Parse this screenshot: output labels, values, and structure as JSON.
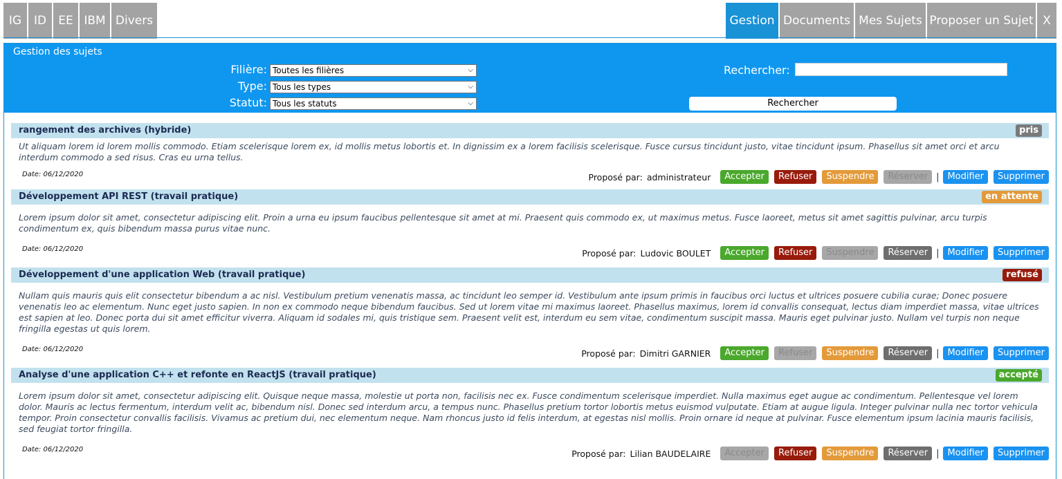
{
  "nav": {
    "left_tabs": [
      "IG",
      "ID",
      "EE",
      "IBM",
      "Divers"
    ],
    "right_tabs": [
      "Gestion",
      "Documents",
      "Mes Sujets",
      "Proposer un Sujet",
      "X"
    ],
    "active_tab": "Gestion"
  },
  "panel": {
    "title": "Gestion des sujets"
  },
  "filters": {
    "filiere_label": "Filière:",
    "filiere_value": "Toutes les filières",
    "type_label": "Type:",
    "type_value": "Tous les types",
    "statut_label": "Statut:",
    "statut_value": "Tous les statuts",
    "search_label": "Rechercher:",
    "search_value": "",
    "search_button": "Rechercher"
  },
  "colors": {
    "accent_blue": "#0f97f0",
    "tab_grey": "#a3a3a3",
    "status_pris": "#7a7a7a",
    "status_en_attente": "#e39a3a",
    "status_refuse": "#981b0c",
    "status_accepte": "#4aa82c"
  },
  "labels": {
    "proposed_by": "Proposé par:",
    "date_prefix": "Date:",
    "accept": "Accepter",
    "refuse": "Refuser",
    "suspend": "Suspendre",
    "reserve": "Réserver",
    "modify": "Modifier",
    "delete": "Supprimer",
    "separator": "|"
  },
  "subjects": [
    {
      "title": "rangement des archives (hybride)",
      "status": "pris",
      "description": "Ut aliquam lorem id lorem mollis commodo. Etiam scelerisque lorem ex, id mollis metus lobortis et. In dignissim ex a lorem facilisis scelerisque. Fusce cursus tincidunt justo, vitae tincidunt ipsum. Phasellus sit amet orci et arcu interdum commodo a sed risus. Cras eu urna tellus.",
      "date": "06/12/2020",
      "author": "administrateur"
    },
    {
      "title": "Développement API REST (travail pratique)",
      "status": "en attente",
      "description": "Lorem ipsum dolor sit amet, consectetur adipiscing elit. Proin a urna eu ipsum faucibus pellentesque sit amet at mi. Praesent quis commodo ex, ut maximus metus. Fusce laoreet, metus sit amet sagittis pulvinar, arcu turpis condimentum ex, quis bibendum massa purus vitae nunc.",
      "date": "06/12/2020",
      "author": "Ludovic BOULET"
    },
    {
      "title": "Développement d'une application Web (travail pratique)",
      "status": "refusé",
      "description": "Nullam quis mauris quis elit consectetur bibendum a ac nisl. Vestibulum pretium venenatis massa, ac tincidunt leo semper id. Vestibulum ante ipsum primis in faucibus orci luctus et ultrices posuere cubilia curae; Donec posuere venenatis leo ac elementum. Nunc eget justo sapien. In non ex commodo neque bibendum faucibus. Sed ut lorem vitae mi maximus laoreet. Phasellus maximus, lorem id convallis consequat, lectus diam imperdiet massa, vitae ultrices est sapien at leo. Donec porta dui sit amet efficitur viverra. Aliquam id sodales mi, quis tristique sem. Praesent velit est, interdum eu sem vitae, condimentum suscipit massa. Mauris eget pulvinar justo. Nullam vel turpis non neque fringilla egestas ut quis lorem.",
      "date": "06/12/2020",
      "author": "Dimitri GARNIER"
    },
    {
      "title": "Analyse d'une application C++ et refonte en ReactJS (travail pratique)",
      "status": "accepté",
      "description": "Lorem ipsum dolor sit amet, consectetur adipiscing elit. Quisque neque massa, molestie ut porta non, facilisis nec ex. Fusce condimentum scelerisque imperdiet. Nulla maximus eget augue ac condimentum. Pellentesque vel lorem dolor. Mauris ac lectus fermentum, interdum velit ac, bibendum nisl. Donec sed interdum arcu, a tempus nunc. Phasellus pretium tortor lobortis metus euismod vulputate. Etiam at augue ligula. Integer pulvinar nulla nec tortor vehicula tempor. Proin consectetur convallis facilisis. Vivamus ac pretium dui, nec elementum neque. Nam rhoncus justo id felis interdum, at egestas nisl mollis. Proin ornare id neque at pulvinar. Fusce elementum ipsum lacinia mauris facilisis, sed feugiat tortor fringilla.",
      "date": "06/12/2020",
      "author": "Lilian BAUDELAIRE"
    }
  ]
}
